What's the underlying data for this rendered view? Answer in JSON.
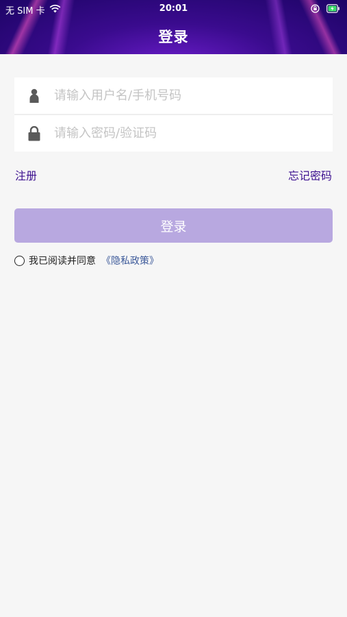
{
  "status_bar": {
    "carrier": "无 SIM 卡",
    "time": "20:01"
  },
  "header": {
    "title": "登录"
  },
  "form": {
    "username_placeholder": "请输入用户名/手机号码",
    "password_placeholder": "请输入密码/验证码"
  },
  "links": {
    "register": "注册",
    "forgot_password": "忘记密码"
  },
  "login_button": {
    "label": "登录"
  },
  "agreement": {
    "text": "我已阅读并同意",
    "privacy_link": "《隐私政策》",
    "checked": false
  },
  "colors": {
    "header_dark": "#1d0466",
    "header_mid": "#3a0b8e",
    "accent_link": "#3b0f8f",
    "button_disabled": "#b8a8e0",
    "privacy_link": "#3d5a9a",
    "background": "#f6f6f6"
  },
  "icons": {
    "wifi": "wifi-icon",
    "orientation_lock": "orientation-lock-icon",
    "battery": "battery-charging-icon",
    "user": "user-icon",
    "lock": "lock-icon"
  }
}
